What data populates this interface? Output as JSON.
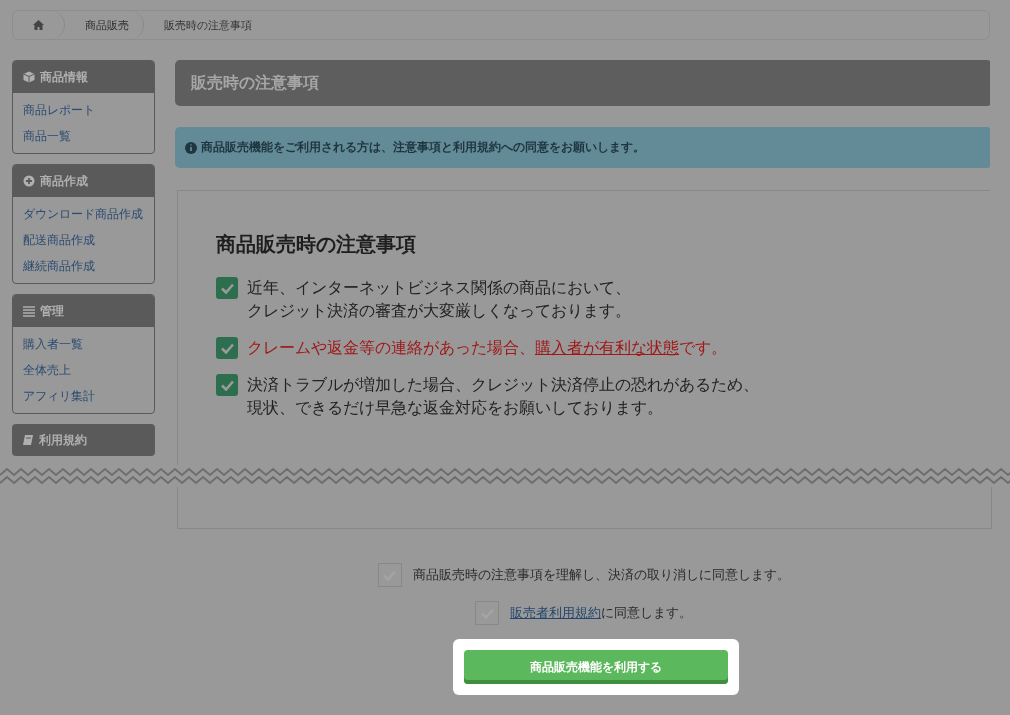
{
  "breadcrumb": [
    {
      "kind": "home"
    },
    {
      "label": "商品販売",
      "kind": "link"
    },
    {
      "label": "販売時の注意事項",
      "kind": "current"
    }
  ],
  "sidebar": [
    {
      "title": "商品情報",
      "items": [
        "商品レポート",
        "商品一覧"
      ]
    },
    {
      "title": "商品作成",
      "items": [
        "ダウンロード商品作成",
        "配送商品作成",
        "継続商品作成"
      ]
    },
    {
      "title": "管理",
      "items": [
        "購入者一覧",
        "全体売上",
        "アフィリ集計"
      ]
    },
    {
      "title": "利用規約"
    }
  ],
  "page_title": "販売時の注意事項",
  "notice": "商品販売機能をご利用される方は、注意事項と利用規約への同意をお願いします。",
  "notes": {
    "heading": "商品販売時の注意事項",
    "items": [
      {
        "checked": true,
        "alert": false,
        "lines": [
          "近年、インターネットビジネス関係の商品において、",
          "クレジット決済の審査が大変厳しくなっております。"
        ]
      },
      {
        "checked": true,
        "alert": true,
        "before": "クレームや返金等の連絡があった場合、",
        "underlined": "購入者が有利な状態",
        "after": "です。"
      },
      {
        "checked": true,
        "alert": false,
        "lines": [
          "決済トラブルが増加した場合、クレジット決済停止の恐れがあるため、",
          "現状、できるだけ早急な返金対応をお願いしております。"
        ]
      }
    ]
  },
  "agreements": [
    {
      "checked": false,
      "text": "商品販売時の注意事項を理解し、決済の取り消しに同意します。"
    },
    {
      "checked": false,
      "link": "販売者利用規約",
      "text": "に同意します。"
    }
  ],
  "submit": {
    "label": "商品販売機能を利用する",
    "highlighted": true
  }
}
